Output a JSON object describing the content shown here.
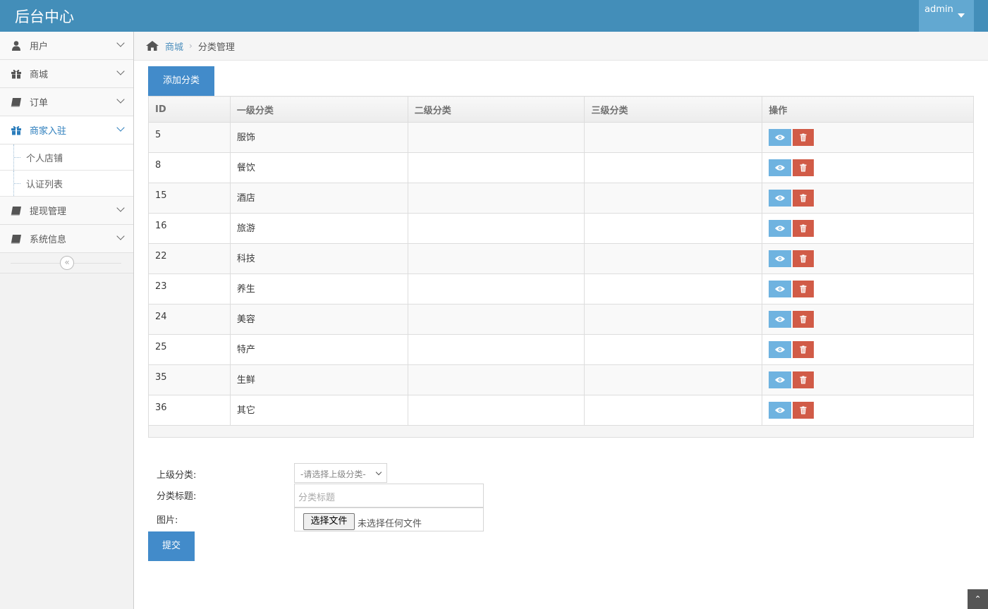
{
  "app": {
    "title": "后台中心",
    "user": "admin"
  },
  "sidebar": {
    "items": [
      {
        "label": "用户",
        "icon": "user-icon"
      },
      {
        "label": "商城",
        "icon": "gift-icon"
      },
      {
        "label": "订单",
        "icon": "book-icon"
      },
      {
        "label": "商家入驻",
        "icon": "gift-icon",
        "active": true,
        "children": [
          {
            "label": "个人店铺"
          },
          {
            "label": "认证列表"
          }
        ]
      },
      {
        "label": "提现管理",
        "icon": "book-icon"
      },
      {
        "label": "系统信息",
        "icon": "book-icon"
      }
    ],
    "collapse_glyph": "«"
  },
  "breadcrumb": {
    "parent": "商城",
    "current": "分类管理"
  },
  "toolbar": {
    "add_label": "添加分类"
  },
  "table": {
    "headers": [
      "ID",
      "一级分类",
      "二级分类",
      "三级分类",
      "操作"
    ],
    "rows": [
      {
        "id": "5",
        "level1": "服饰",
        "level2": "",
        "level3": ""
      },
      {
        "id": "8",
        "level1": "餐饮",
        "level2": "",
        "level3": ""
      },
      {
        "id": "15",
        "level1": "酒店",
        "level2": "",
        "level3": ""
      },
      {
        "id": "16",
        "level1": "旅游",
        "level2": "",
        "level3": ""
      },
      {
        "id": "22",
        "level1": "科技",
        "level2": "",
        "level3": ""
      },
      {
        "id": "23",
        "level1": "养生",
        "level2": "",
        "level3": ""
      },
      {
        "id": "24",
        "level1": "美容",
        "level2": "",
        "level3": ""
      },
      {
        "id": "25",
        "level1": "特产",
        "level2": "",
        "level3": ""
      },
      {
        "id": "35",
        "level1": "生鲜",
        "level2": "",
        "level3": ""
      },
      {
        "id": "36",
        "level1": "其它",
        "level2": "",
        "level3": ""
      }
    ]
  },
  "form": {
    "parent_label": "上级分类:",
    "parent_select_value": "-请选择上级分类-",
    "title_label": "分类标题:",
    "title_placeholder": "分类标题",
    "image_label": "图片:",
    "file_button": "选择文件",
    "file_status": "未选择任何文件",
    "submit_label": "提交"
  },
  "colors": {
    "navbar": "#438eb9",
    "primary": "#428bca",
    "view": "#6fb3e0",
    "delete": "#d15b47"
  }
}
